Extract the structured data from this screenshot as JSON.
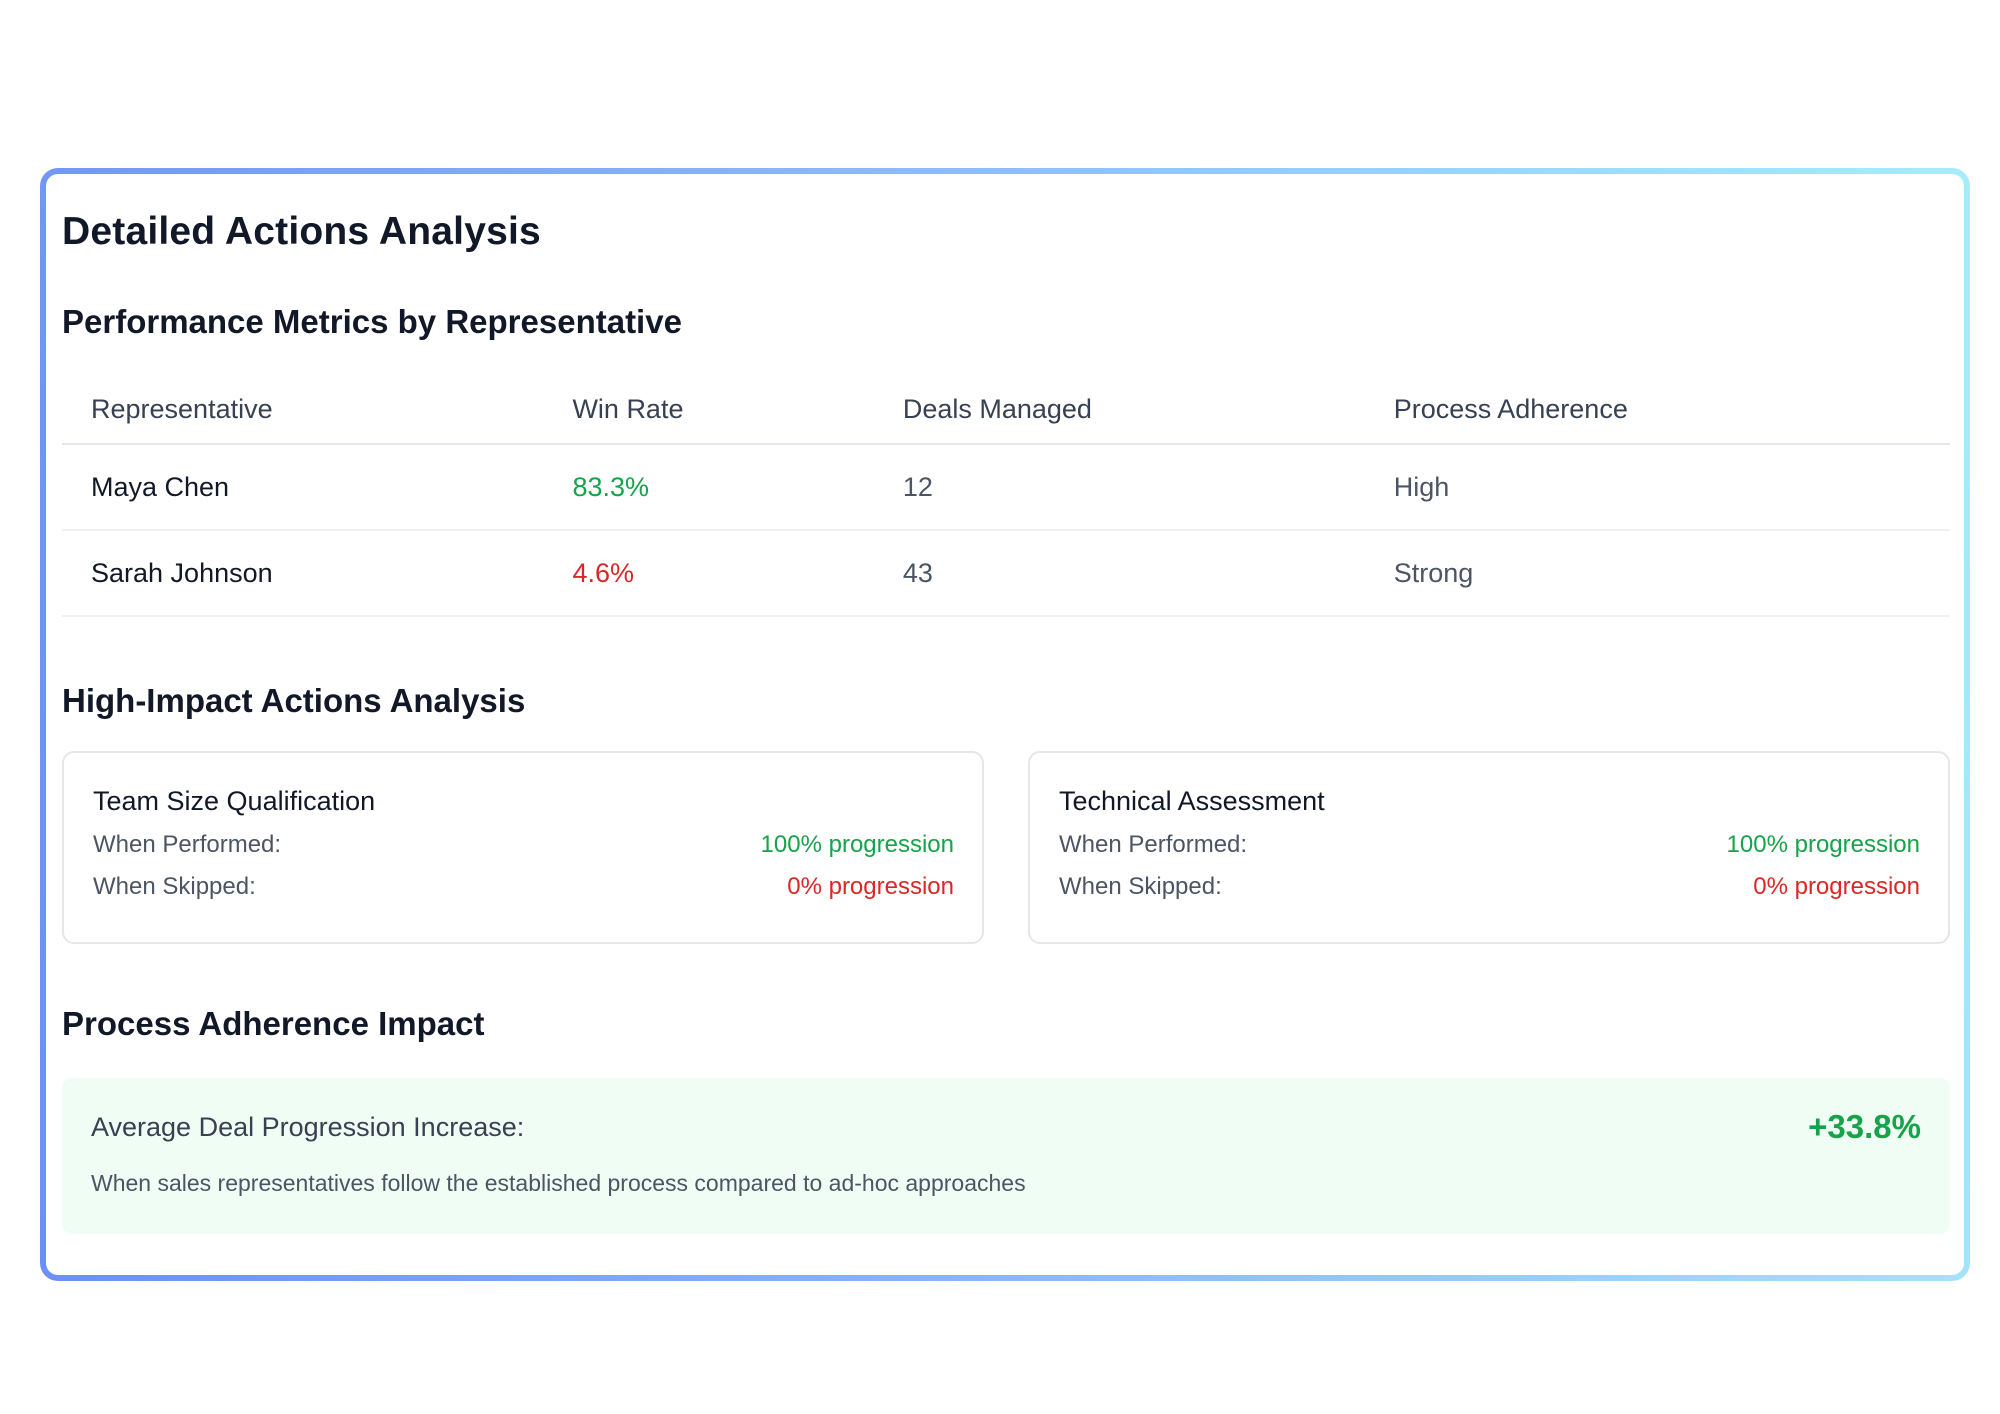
{
  "title": "Detailed Actions Analysis",
  "performance": {
    "heading": "Performance Metrics by Representative",
    "columns": [
      "Representative",
      "Win Rate",
      "Deals Managed",
      "Process Adherence"
    ],
    "rows": [
      {
        "name": "Maya Chen",
        "win_rate": "83.3%",
        "deals": "12",
        "adherence": "High",
        "status": "good"
      },
      {
        "name": "Sarah Johnson",
        "win_rate": "4.6%",
        "deals": "43",
        "adherence": "Strong",
        "status": "bad"
      }
    ]
  },
  "actions": {
    "heading": "High-Impact Actions Analysis",
    "cards": [
      {
        "title": "Team Size Qualification",
        "performed_label": "When Performed:",
        "performed_value": "100% progression",
        "skipped_label": "When Skipped:",
        "skipped_value": "0% progression"
      },
      {
        "title": "Technical Assessment",
        "performed_label": "When Performed:",
        "performed_value": "100% progression",
        "skipped_label": "When Skipped:",
        "skipped_value": "0% progression"
      }
    ]
  },
  "impact": {
    "heading": "Process Adherence Impact",
    "label": "Average Deal Progression Increase:",
    "value": "+33.8%",
    "description": "When sales representatives follow the established process compared to ad-hoc approaches"
  },
  "colors": {
    "positive": "#16a34a",
    "negative": "#dc2626",
    "impact_bg": "#f0fdf4"
  }
}
